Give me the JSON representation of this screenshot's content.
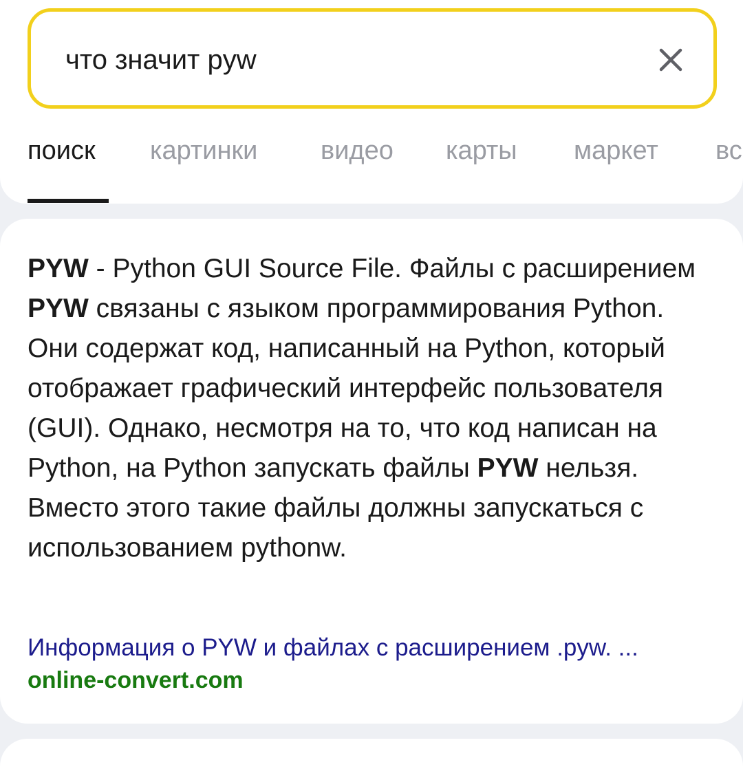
{
  "search": {
    "query": "что значит pyw",
    "clear_icon": "close-icon"
  },
  "tabs": [
    {
      "label": "поиск",
      "active": true
    },
    {
      "label": "картинки",
      "active": false
    },
    {
      "label": "видео",
      "active": false
    },
    {
      "label": "карты",
      "active": false
    },
    {
      "label": "маркет",
      "active": false
    },
    {
      "label": "вс",
      "active": false
    }
  ],
  "result": {
    "snippet_parts": [
      {
        "text": "PYW",
        "bold": true
      },
      {
        "text": " - Python GUI Source File. Файлы с расширением ",
        "bold": false
      },
      {
        "text": "PYW",
        "bold": true
      },
      {
        "text": " связаны с языком программирования Python. Они содержат код, написанный на Python, который отображает графический интерфейс пользователя (GUI). Однако, несмотря на то, что код написан на Python, на Python запускать файлы ",
        "bold": false
      },
      {
        "text": "PYW",
        "bold": true
      },
      {
        "text": " нельзя. Вместо этого такие файлы должны запускаться с использованием pythonw.",
        "bold": false
      }
    ],
    "link_title": "Информация о PYW и файлах с расширением .pyw. ...",
    "domain": "online-convert.com"
  },
  "colors": {
    "search_border": "#f2d01c",
    "link": "#1c1c8c",
    "domain": "#187a10",
    "tab_inactive": "#9a9ca3"
  }
}
